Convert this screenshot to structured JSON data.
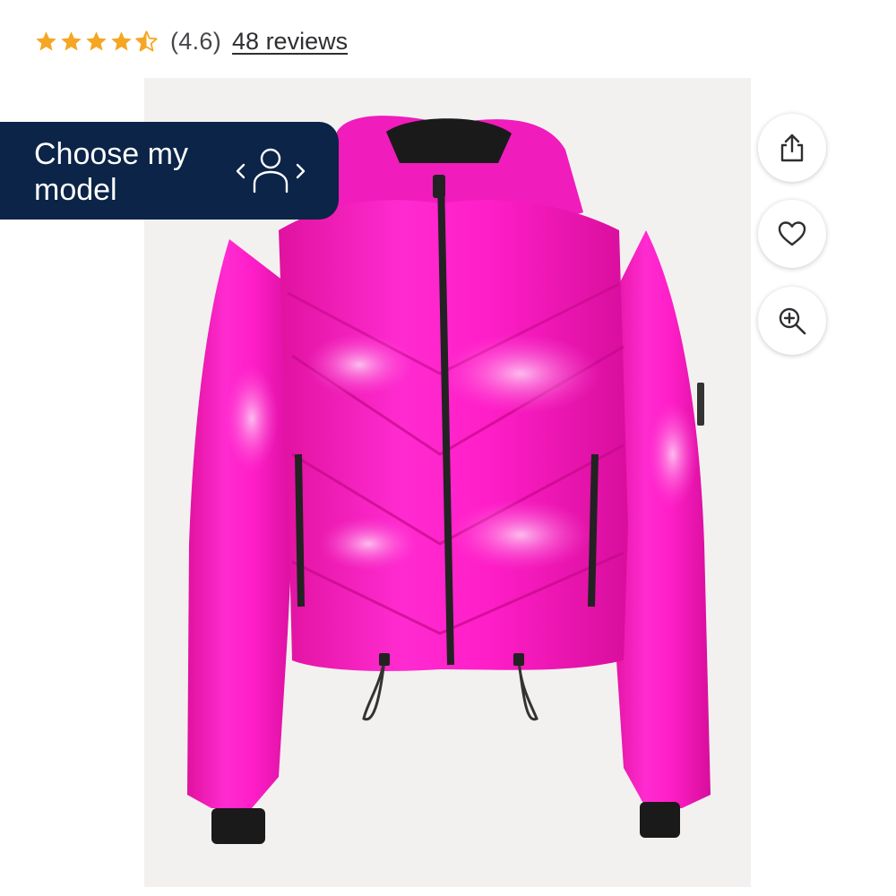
{
  "rating": {
    "stars_value": 4.6,
    "value_text": "(4.6)",
    "reviews_text": "48 reviews",
    "star_color": "#f5a623"
  },
  "product_image": {
    "icon": "pink-puffer-jacket",
    "jacket_color": "#ff1ec8",
    "background_color": "#f2f1f0"
  },
  "model_chooser": {
    "label": "Choose my model",
    "icon": "person-switch-icon",
    "background_color": "#0b2447"
  },
  "actions": [
    {
      "name": "share",
      "icon": "share-icon"
    },
    {
      "name": "favorite",
      "icon": "heart-icon"
    },
    {
      "name": "zoom",
      "icon": "zoom-in-icon"
    }
  ]
}
